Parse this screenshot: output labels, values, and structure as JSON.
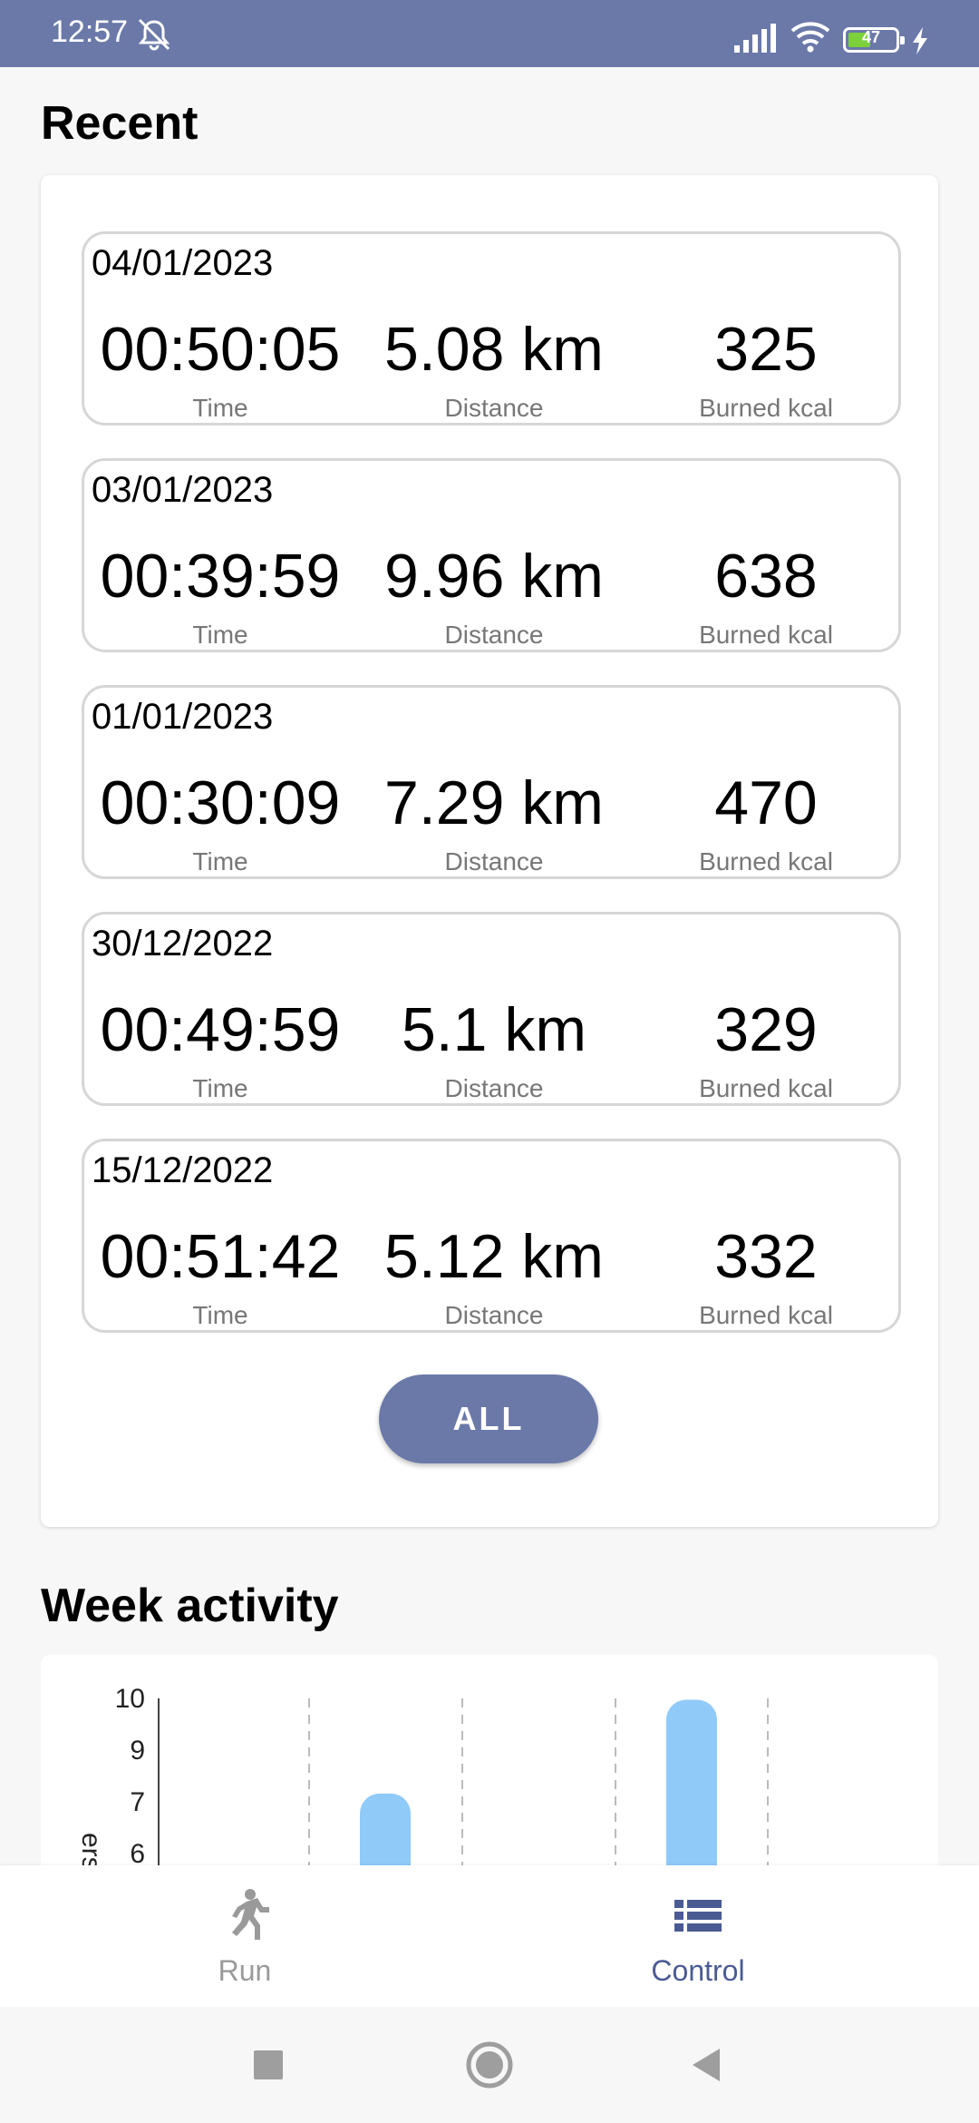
{
  "status_bar": {
    "time": "12:57",
    "battery_level": "47",
    "battery_percent": 47,
    "icons": [
      "mute-icon",
      "signal-icon",
      "wifi-icon",
      "battery-icon",
      "charging-icon"
    ]
  },
  "recent": {
    "title": "Recent",
    "runs": [
      {
        "date": "04/01/2023",
        "time": "00:50:05",
        "distance": "5.08 km",
        "kcal": "325"
      },
      {
        "date": "03/01/2023",
        "time": "00:39:59",
        "distance": "9.96 km",
        "kcal": "638"
      },
      {
        "date": "01/01/2023",
        "time": "00:30:09",
        "distance": "7.29 km",
        "kcal": "470"
      },
      {
        "date": "30/12/2022",
        "time": "00:49:59",
        "distance": "5.1 km",
        "kcal": "329"
      },
      {
        "date": "15/12/2022",
        "time": "00:51:42",
        "distance": "5.12 km",
        "kcal": "332"
      }
    ],
    "labels": {
      "time": "Time",
      "distance": "Distance",
      "kcal": "Burned kcal"
    },
    "all_button": "ALL"
  },
  "week": {
    "title": "Week activity"
  },
  "chart_data": {
    "type": "bar",
    "ylabel_visible_fragment": "ers",
    "y_ticks": [
      "10",
      "9",
      "7",
      "6"
    ],
    "bars": [
      {
        "value": 7.29
      },
      {
        "value": 9.96
      }
    ],
    "grid": "vertical dashed",
    "bar_color": "#90caf9"
  },
  "nav": {
    "run": "Run",
    "control": "Control"
  },
  "colors": {
    "accent": "#6b79a9",
    "nav_active": "#4a5b94",
    "bar": "#90caf9"
  }
}
